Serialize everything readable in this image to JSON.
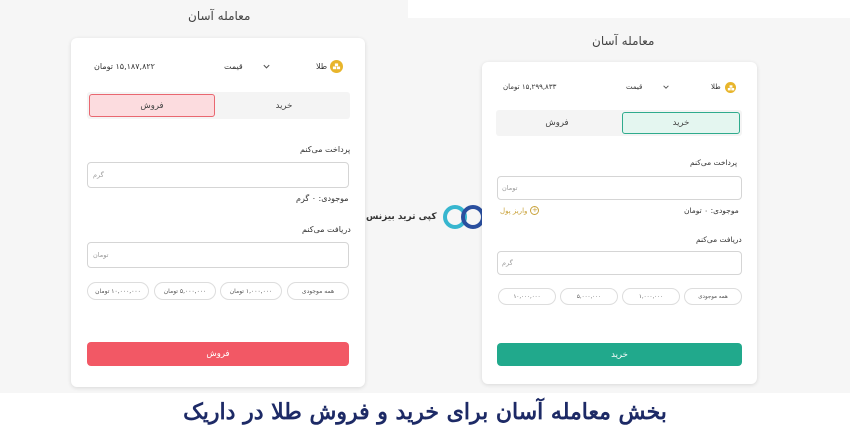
{
  "left": {
    "title": "معامله آسان",
    "asset_label": "طلا",
    "price_label": "قیمت",
    "price_value": "۱۵,۱۸۷,۸۲۲ تومان",
    "tab_buy": "خرید",
    "tab_sell": "فروش",
    "pay_label": "پرداخت می‌کنم",
    "pay_placeholder": "گرم",
    "balance": "موجودی: ۰ گرم",
    "receive_label": "دریافت می‌کنم",
    "receive_placeholder": "تومان",
    "chips": [
      "همه موجودی",
      "۱,۰۰۰,۰۰۰ تومان",
      "۵,۰۰۰,۰۰۰ تومان",
      "۱۰,۰۰۰,۰۰۰ تومان"
    ],
    "submit": "فروش"
  },
  "right": {
    "title": "معامله آسان",
    "asset_label": "طلا",
    "price_label": "قیمت",
    "price_value": "۱۵,۲۹۹,۸۳۳ تومان",
    "tab_buy": "خرید",
    "tab_sell": "فروش",
    "pay_label": "پرداخت می‌کنم",
    "pay_placeholder": "تومان",
    "balance": "موجودی: ۰ تومان",
    "deposit": "واریز پول",
    "receive_label": "دریافت می‌کنم",
    "receive_placeholder": "گرم",
    "chips": [
      "همه موجودی",
      "۱,۰۰۰,۰۰۰",
      "۵,۰۰۰,۰۰۰",
      "۱۰,۰۰۰,۰۰۰"
    ],
    "submit": "خرید"
  },
  "watermark": "کپی ترید بیزنس",
  "caption": "بخش معامله آسان برای خرید و فروش طلا در داریک",
  "colors": {
    "sell": "#f25865",
    "buy": "#21a98c",
    "gold": "#e8b52b",
    "caption": "#1d2a66"
  },
  "icons": [
    "gold-icon",
    "chevron-down-icon",
    "plus-circle-icon",
    "logo-icon"
  ]
}
